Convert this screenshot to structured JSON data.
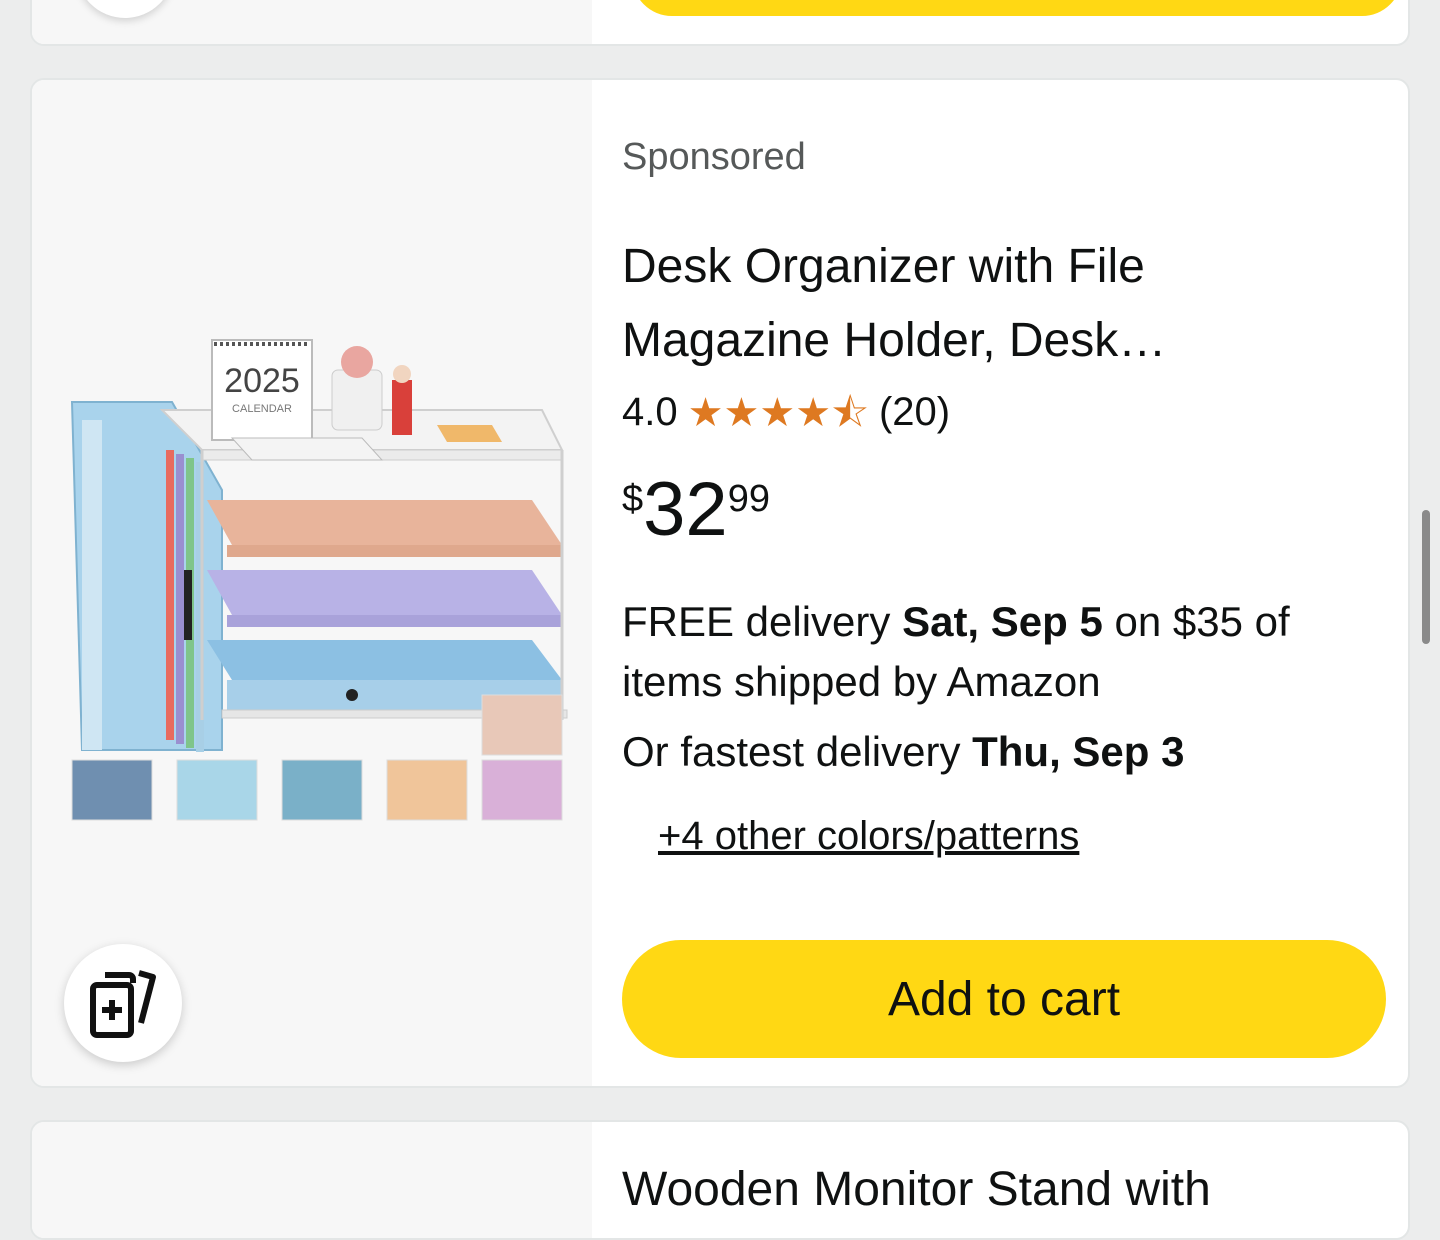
{
  "product": {
    "sponsored_label": "Sponsored",
    "title_line1": "Desk Organizer with File",
    "title_line2": "Magazine Holder, Desk…",
    "rating": "4.0",
    "stars": [
      1,
      1,
      1,
      1,
      0.5
    ],
    "review_count": "(20)",
    "price_symbol": "$",
    "price_whole": "32",
    "price_fraction": "99",
    "delivery_prefix": "FREE delivery ",
    "delivery_date": "Sat, Sep 5",
    "delivery_suffix": " on $35 of items shipped by Amazon",
    "fastest_prefix": "Or fastest delivery ",
    "fastest_date": "Thu, Sep 3",
    "other_colors": "+4 other colors/patterns",
    "add_to_cart_label": "Add to cart",
    "image_calendar_year": "2025",
    "image_calendar_word": "CALENDAR"
  },
  "next_product": {
    "title": "Wooden Monitor Stand with"
  },
  "colors": {
    "star": "#de7921",
    "cart_button": "#ffd814",
    "sponsored_text": "#565959"
  }
}
